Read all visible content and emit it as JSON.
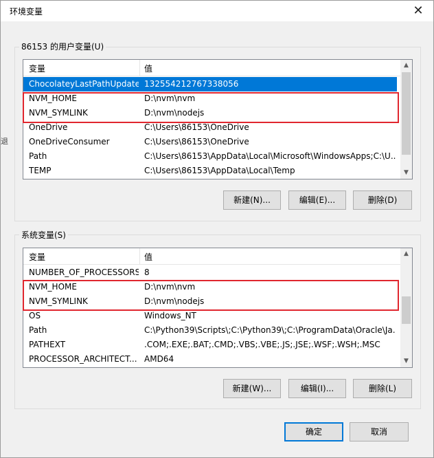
{
  "window": {
    "title": "环境变量",
    "close_glyph": "✕"
  },
  "side_mark": "退",
  "user_vars": {
    "group_label": "86153 的用户变量(U)",
    "col_name": "变量",
    "col_value": "值",
    "rows": [
      {
        "name": "ChocolateyLastPathUpdate",
        "value": "132554212767338056"
      },
      {
        "name": "NVM_HOME",
        "value": "D:\\nvm\\nvm"
      },
      {
        "name": "NVM_SYMLINK",
        "value": "D:\\nvm\\nodejs"
      },
      {
        "name": "OneDrive",
        "value": "C:\\Users\\86153\\OneDrive"
      },
      {
        "name": "OneDriveConsumer",
        "value": "C:\\Users\\86153\\OneDrive"
      },
      {
        "name": "Path",
        "value": "C:\\Users\\86153\\AppData\\Local\\Microsoft\\WindowsApps;C:\\U..."
      },
      {
        "name": "TEMP",
        "value": "C:\\Users\\86153\\AppData\\Local\\Temp"
      }
    ],
    "buttons": {
      "new": "新建(N)...",
      "edit": "编辑(E)...",
      "delete": "删除(D)"
    }
  },
  "system_vars": {
    "group_label": "系统变量(S)",
    "col_name": "变量",
    "col_value": "值",
    "rows": [
      {
        "name": "NUMBER_OF_PROCESSORS",
        "value": "8"
      },
      {
        "name": "NVM_HOME",
        "value": "D:\\nvm\\nvm"
      },
      {
        "name": "NVM_SYMLINK",
        "value": "D:\\nvm\\nodejs"
      },
      {
        "name": "OS",
        "value": "Windows_NT"
      },
      {
        "name": "Path",
        "value": "C:\\Python39\\Scripts\\;C:\\Python39\\;C:\\ProgramData\\Oracle\\Ja..."
      },
      {
        "name": "PATHEXT",
        "value": ".COM;.EXE;.BAT;.CMD;.VBS;.VBE;.JS;.JSE;.WSF;.WSH;.MSC"
      },
      {
        "name": "PROCESSOR_ARCHITECT...",
        "value": "AMD64"
      }
    ],
    "buttons": {
      "new": "新建(W)...",
      "edit": "编辑(I)...",
      "delete": "删除(L)"
    }
  },
  "footer": {
    "ok": "确定",
    "cancel": "取消"
  },
  "colors": {
    "selection": "#0078d7",
    "highlight_box": "#e0262e"
  },
  "scroll_arrows": {
    "up": "▲",
    "down": "▼"
  }
}
